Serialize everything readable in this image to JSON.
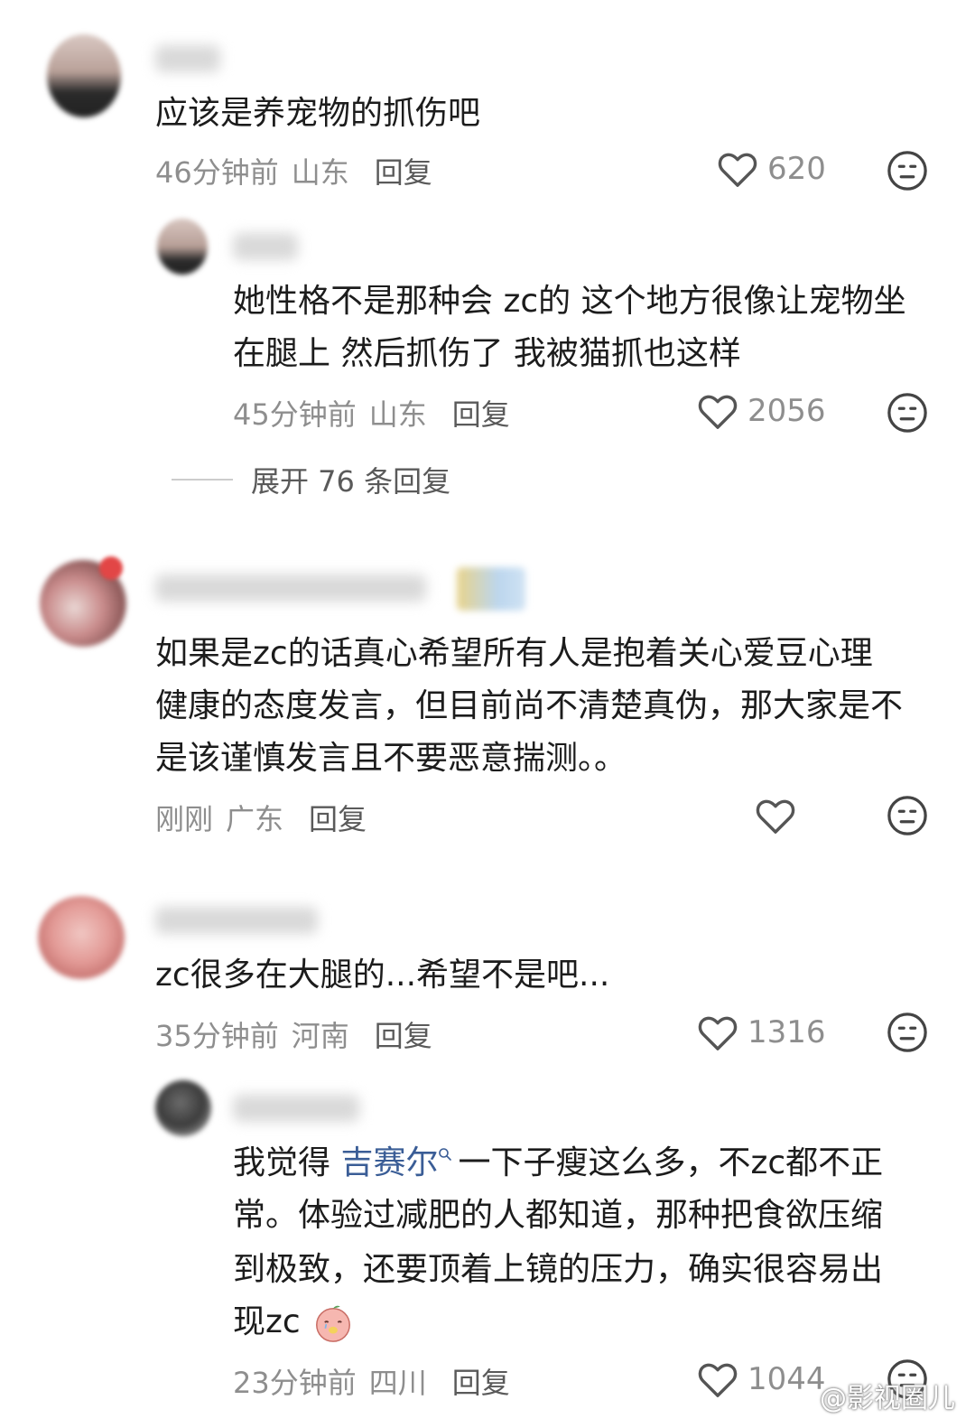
{
  "comments": [
    {
      "text": "应该是养宠物的抓伤吧",
      "time": "46分钟前",
      "location": "山东",
      "reply_label": "回复",
      "likes": "620",
      "replies": [
        {
          "lines": [
            "她性格不是那种会 zc的 这个地方很像让宠物坐",
            "在腿上 然后抓伤了 我被猫抓也这样"
          ],
          "time": "45分钟前",
          "location": "山东",
          "reply_label": "回复",
          "likes": "2056"
        }
      ],
      "expand_label": "展开 76 条回复"
    },
    {
      "lines": [
        "如果是zc的话真心希望所有人是抱着关心爱豆心理",
        "健康的态度发言，但目前尚不清楚真伪，那大家是不",
        "是该谨慎发言且不要恶意揣测。。"
      ],
      "time": "刚刚",
      "location": "广东",
      "reply_label": "回复",
      "likes": ""
    },
    {
      "text": "zc很多在大腿的...希望不是吧...",
      "time": "35分钟前",
      "location": "河南",
      "reply_label": "回复",
      "likes": "1316",
      "replies": [
        {
          "line1_before": "我觉得 ",
          "mention": "吉赛尔",
          "line1_after": "一下子瘦这么多，不zc都不正",
          "lines_rest": [
            "常。体验过减肥的人都知道，那种把食欲压缩",
            "到极致，还要顶着上镜的压力，确实很容易出"
          ],
          "last_line": "现zc",
          "time": "23分钟前",
          "location": "四川",
          "reply_label": "回复",
          "likes": "1044"
        }
      ]
    }
  ],
  "watermark": "@影视圈儿",
  "icons": {
    "like": "heart-outline-icon",
    "dislike": "neutral-face-icon",
    "mention": "search-icon",
    "emoji": "crying-peach-emoji-icon",
    "weibo": "weibo-logo-icon"
  },
  "colors": {
    "meta": "#8e8e8e",
    "mention": "#3a5d96"
  }
}
